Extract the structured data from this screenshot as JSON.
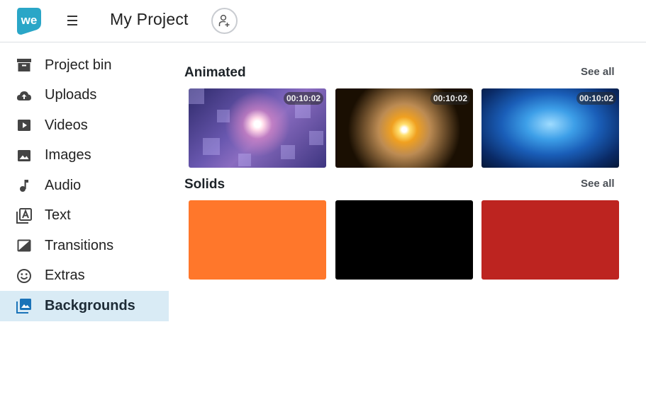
{
  "app": {
    "logo_text": "we",
    "project_title": "My Project",
    "brand_color": "#2aa6c7"
  },
  "sidebar": {
    "items": [
      {
        "label": "Project bin",
        "icon": "archive-icon"
      },
      {
        "label": "Uploads",
        "icon": "cloud-upload-icon"
      },
      {
        "label": "Videos",
        "icon": "play-icon"
      },
      {
        "label": "Images",
        "icon": "image-icon"
      },
      {
        "label": "Audio",
        "icon": "music-note-icon"
      },
      {
        "label": "Text",
        "icon": "text-icon"
      },
      {
        "label": "Transitions",
        "icon": "transition-icon"
      },
      {
        "label": "Extras",
        "icon": "smiley-icon"
      },
      {
        "label": "Backgrounds",
        "icon": "backgrounds-icon",
        "active": true
      }
    ]
  },
  "main": {
    "animated": {
      "title": "Animated",
      "see_all": "See all",
      "items": [
        {
          "duration": "00:10:02"
        },
        {
          "duration": "00:10:02"
        },
        {
          "duration": "00:10:02"
        }
      ]
    },
    "solids": {
      "title": "Solids",
      "see_all": "See all",
      "colors": [
        "#ff772b",
        "#000000",
        "#bd2420"
      ]
    }
  }
}
